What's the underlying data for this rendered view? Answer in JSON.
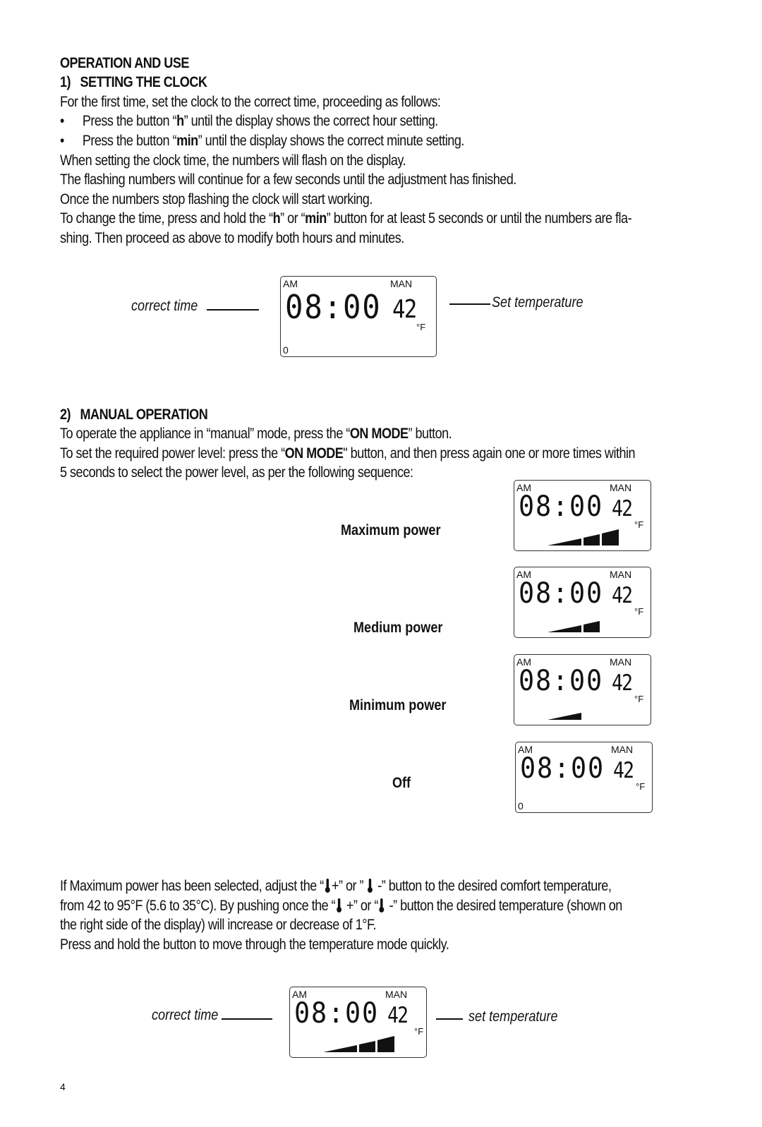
{
  "section_title": "OPERATION AND USE",
  "clock": {
    "heading": "1)   SETTING THE CLOCK",
    "intro": "For the first time, set the clock to the correct time, proceeding as follows:",
    "bullets": [
      {
        "pre": "Press the button  “",
        "key": "h",
        "post": "” until the display shows the correct hour setting."
      },
      {
        "pre": "Press the button “",
        "key": "min",
        "post": "” until the display shows the correct minute setting."
      }
    ],
    "lines": [
      "When setting the clock time, the numbers will flash on the display.",
      "The flashing numbers will continue for a few seconds until the adjustment has finished.",
      "Once the numbers stop flashing the clock will start working."
    ],
    "change": {
      "p1": "To change the time, press and hold the “",
      "k1": "h",
      "p2": "” or “",
      "k2": "min",
      "p3": "” button for at least 5 seconds or until the numbers are fla-",
      "line2": "shing. Then proceed as above to modify both hours and minutes."
    },
    "diagram": {
      "left_label": "correct time",
      "right_label": "Set temperature"
    }
  },
  "manual": {
    "heading": "2)   MANUAL OPERATION",
    "l1_pre": "To operate the appliance in “manual” mode, press the “",
    "l1_key": "ON MODE",
    "l1_post": "” button.",
    "l2_pre": "To set the required power level: press the “",
    "l2_key": "ON MODE",
    "l2_post": "\" button, and then press again one or more times within",
    "l3": "5 seconds to select the power level, as per the following sequence:",
    "modes": [
      {
        "label": "Maximum power",
        "bars": 3
      },
      {
        "label": "Medium power",
        "bars": 2
      },
      {
        "label": "Minimum power",
        "bars": 1
      },
      {
        "label": "Off",
        "bars": 0
      }
    ]
  },
  "temperature": {
    "p1_a": "If Maximum power has been selected, adjust the “",
    "p1_b": "+” or ” ",
    "p1_c": " -” button to the desired comfort temperature,",
    "p2_a": "from 42 to 95°F (5.6 to 35°C). By pushing once the “",
    "p2_b": " +” or “",
    "p2_c": " -” button the desired temperature (shown on",
    "p3": "the right side of the display) will increase or decrease of 1°F.",
    "p4": "Press and hold the button to move through the temperature mode quickly.",
    "diagram": {
      "left_label": "correct time",
      "right_label": "set temperature"
    }
  },
  "lcd": {
    "am": "AM",
    "man": "MAN",
    "time": "08:00",
    "temp": "42",
    "unit": "°F",
    "off_indicator": "0"
  },
  "page_number": "4"
}
